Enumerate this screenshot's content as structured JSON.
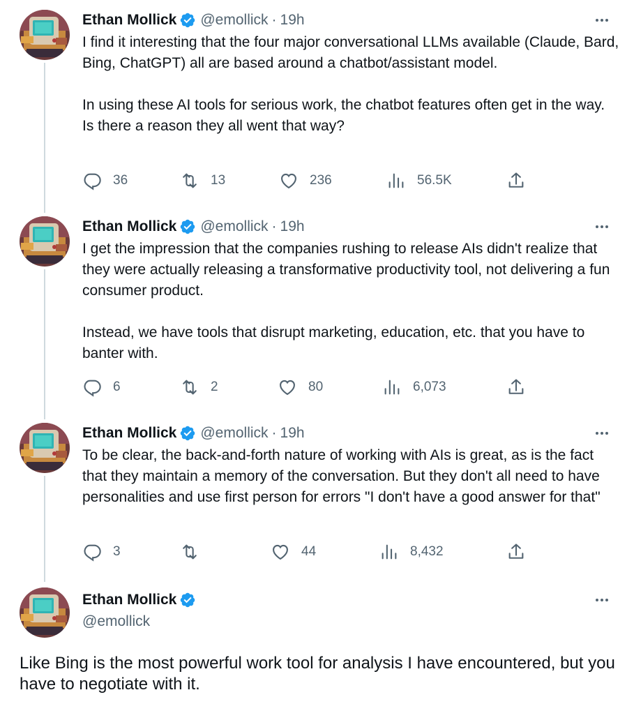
{
  "tweets": [
    {
      "author": "Ethan Mollick",
      "handle": "@emollick",
      "sep": "·",
      "time": "19h",
      "paragraphs": [
        "I find it interesting that the four major conversational LLMs available (Claude, Bard, Bing, ChatGPT) all are based around a chatbot/assistant model.",
        "In using these AI tools for serious work, the chatbot features often get in the way. Is there a reason they all went that way?"
      ],
      "replies": "36",
      "retweets": "13",
      "likes": "236",
      "views": "56.5K"
    },
    {
      "author": "Ethan Mollick",
      "handle": "@emollick",
      "sep": "·",
      "time": "19h",
      "paragraphs": [
        "I get the impression that the companies rushing to release AIs didn't realize that they were actually releasing a transformative productivity tool, not delivering a fun consumer product.",
        "Instead, we have tools that disrupt marketing, education, etc. that you have to banter with."
      ],
      "replies": "6",
      "retweets": "2",
      "likes": "80",
      "views": "6,073"
    },
    {
      "author": "Ethan Mollick",
      "handle": "@emollick",
      "sep": "·",
      "time": "19h",
      "paragraphs": [
        "To be clear, the back-and-forth nature of working with AIs is great, as is the fact that they maintain a memory of the conversation. But they don't all need to have personalities and use first person for errors \"I don't have a good answer for that\""
      ],
      "replies": "3",
      "retweets": "",
      "likes": "44",
      "views": "8,432"
    }
  ],
  "main_tweet": {
    "author": "Ethan Mollick",
    "handle": "@emollick",
    "text": "Like Bing is the most powerful work tool for analysis I have encountered, but you have to negotiate with it."
  },
  "colors": {
    "text": "#0f1419",
    "secondary": "#536471",
    "verified": "#1d9bf0",
    "thread_line": "#cfd9de"
  },
  "icons": {
    "verified": "verified-badge-icon",
    "more": "more-options-icon",
    "reply": "reply-icon",
    "retweet": "retweet-icon",
    "like": "heart-icon",
    "views": "views-chart-icon",
    "share": "share-icon"
  }
}
